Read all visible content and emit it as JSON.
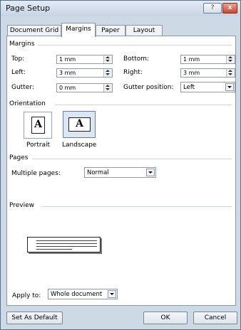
{
  "window": {
    "title": "Page Setup",
    "help_glyph": "?",
    "close_glyph": "x"
  },
  "tabs": [
    {
      "label": "Document Grid",
      "active": false
    },
    {
      "label": "Margins",
      "active": true
    },
    {
      "label": "Paper",
      "active": false
    },
    {
      "label": "Layout",
      "active": false
    }
  ],
  "margins": {
    "section_label": "Margins",
    "top": {
      "label": "Top:",
      "value": "1 mm"
    },
    "left": {
      "label": "Left:",
      "value": "3 mm"
    },
    "gutter": {
      "label": "Gutter:",
      "value": "0 mm"
    },
    "bottom": {
      "label": "Bottom:",
      "value": "1 mm"
    },
    "right": {
      "label": "Right:",
      "value": "3 mm"
    },
    "gutter_position": {
      "label": "Gutter position:",
      "value": "Left"
    }
  },
  "orientation": {
    "section_label": "Orientation",
    "portrait": {
      "label": "Portrait",
      "glyph": "A",
      "selected": false
    },
    "landscape": {
      "label": "Landscape",
      "glyph": "A",
      "selected": true
    }
  },
  "pages": {
    "section_label": "Pages",
    "multiple_pages": {
      "label": "Multiple pages:",
      "value": "Normal"
    }
  },
  "preview": {
    "section_label": "Preview"
  },
  "apply_to": {
    "label": "Apply to:",
    "value": "Whole document"
  },
  "buttons": {
    "set_default": "Set As Default",
    "ok": "OK",
    "cancel": "Cancel"
  }
}
